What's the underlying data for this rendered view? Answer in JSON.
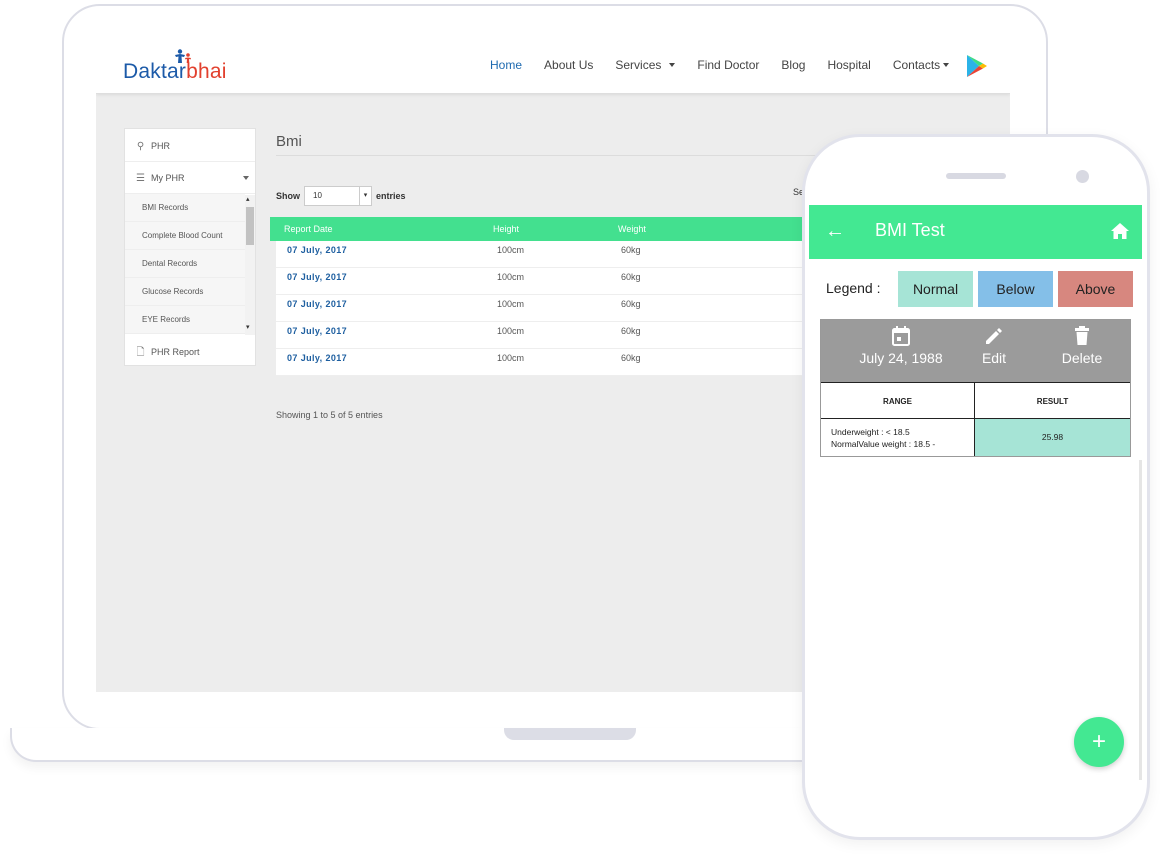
{
  "brand": {
    "part1": "Daktar",
    "part2": "bhai"
  },
  "nav": {
    "items": [
      {
        "label": "Home",
        "active": true,
        "dropdown": false
      },
      {
        "label": "About Us",
        "active": false,
        "dropdown": false
      },
      {
        "label": "Services",
        "active": false,
        "dropdown": true
      },
      {
        "label": "Find Doctor",
        "active": false,
        "dropdown": false
      },
      {
        "label": "Blog",
        "active": false,
        "dropdown": false
      },
      {
        "label": "Hospital",
        "active": false,
        "dropdown": false
      },
      {
        "label": "Contacts",
        "active": false,
        "dropdown": true
      }
    ],
    "play_store_icon": "play-store-icon"
  },
  "sidebar": {
    "phr": "PHR",
    "my_phr": "My PHR",
    "sub_items": [
      "BMI Records",
      "Complete Blood Count",
      "Dental Records",
      "Glucose Records",
      "EYE Records"
    ],
    "report": "PHR Report"
  },
  "content": {
    "title": "Bmi",
    "show_label": "Show",
    "entries_value": "10",
    "entries_label": "entries",
    "search_label": "Se",
    "columns": [
      "Report Date",
      "Height",
      "Weight"
    ],
    "rows": [
      {
        "date": "07 July, 2017",
        "height": "100cm",
        "weight": "60kg"
      },
      {
        "date": "07 July, 2017",
        "height": "100cm",
        "weight": "60kg"
      },
      {
        "date": "07 July, 2017",
        "height": "100cm",
        "weight": "60kg"
      },
      {
        "date": "07 July, 2017",
        "height": "100cm",
        "weight": "60kg"
      },
      {
        "date": "07 July, 2017",
        "height": "100cm",
        "weight": "60kg"
      }
    ],
    "info": "Showing 1 to 5 of 5 entries"
  },
  "phone": {
    "back_icon": "arrow-left-icon",
    "title": "BMI Test",
    "home_icon": "home-icon",
    "legend_label": "Legend :",
    "legend": [
      {
        "label": "Normal",
        "color": "#a6e4d6"
      },
      {
        "label": "Below",
        "color": "#84bfe8"
      },
      {
        "label": "Above",
        "color": "#d7877f"
      }
    ],
    "card": {
      "date": "July 24, 1988",
      "edit": "Edit",
      "delete": "Delete",
      "range_header": "RANGE",
      "result_header": "RESULT",
      "range_line1": "Underweight : < 18.5",
      "range_line2": "NormalValue weight : 18.5 -",
      "result": "25.98",
      "result_color": "#a6e4d6"
    },
    "fab_label": "+",
    "accent": "#43e892"
  }
}
